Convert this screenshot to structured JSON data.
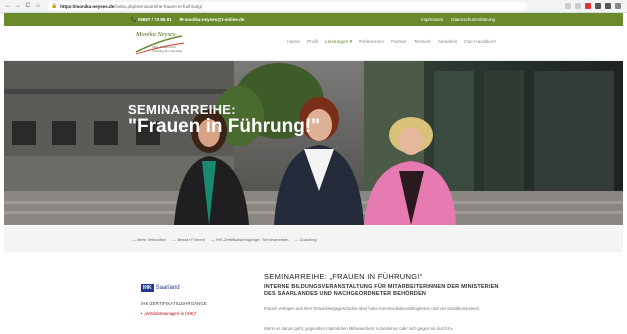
{
  "browser": {
    "url_host": "https://monika-neyses.de",
    "url_path": "/index.php/seminarreihe-frauen-in-fuehrung/",
    "nav": [
      "←",
      "→",
      "C",
      "⌂"
    ]
  },
  "topbar": {
    "phone": "06897 / 73 86 61",
    "email": "monika-neyses@t-online.de",
    "links": [
      "Impressum",
      "Datenschutzerklärung"
    ]
  },
  "logo": {
    "name": "Monika Neyses",
    "subtitle_1": "Dipl. Volkswirtin",
    "subtitle_2": "Training & Coaching"
  },
  "menu": [
    {
      "label": "Home"
    },
    {
      "label": "Profil"
    },
    {
      "label": "Leistungen ▾",
      "active": true
    },
    {
      "label": "Referenzen"
    },
    {
      "label": "Partner"
    },
    {
      "label": "Termine"
    },
    {
      "label": "Aktuelles"
    },
    {
      "label": "Das Handbuch"
    }
  ],
  "hero": {
    "line1": "SEMINARREIHE:",
    "line2": "\"Frauen in Führung!\""
  },
  "subnav": [
    "— Mehr Verkaufen!",
    "— Besser Führen!",
    "— IHK-Zertifikatslehrgänge / Seminarreihen",
    "— Coaching"
  ],
  "sidebar": {
    "ihk_box": "IHK",
    "ihk_region": "Saarland",
    "heading": "IHK-ZERTIFIKATSLEHRGÄNGE",
    "link": "„Vertriebsmanager/-in (IHK)“"
  },
  "main": {
    "title": "SEMINARREIHE: „FRAUEN IN FÜHRUNG!“",
    "subtitle": "INTERNE BILDUNGSVERANSTALTUNG FÜR MITARBEITERINNEN DER MINISTERIEN DES SAARLANDES UND NACHGEORDNETER BEHÖRDEN",
    "para1": "Frauen verfügen aus ihrer Entwicklungsgeschichte über hohe Kommunikationsfähigkeiten und viel Sozialkompetenz.",
    "para2": "Wenn es darum geht, gegenüber männlichen Mitbewerbern zu bestehen oder sich gegen sie durchzu-"
  },
  "colors": {
    "brand_green": "#6b8a2c",
    "accent_red": "#b00000",
    "ihk_blue": "#1f3d8c"
  }
}
